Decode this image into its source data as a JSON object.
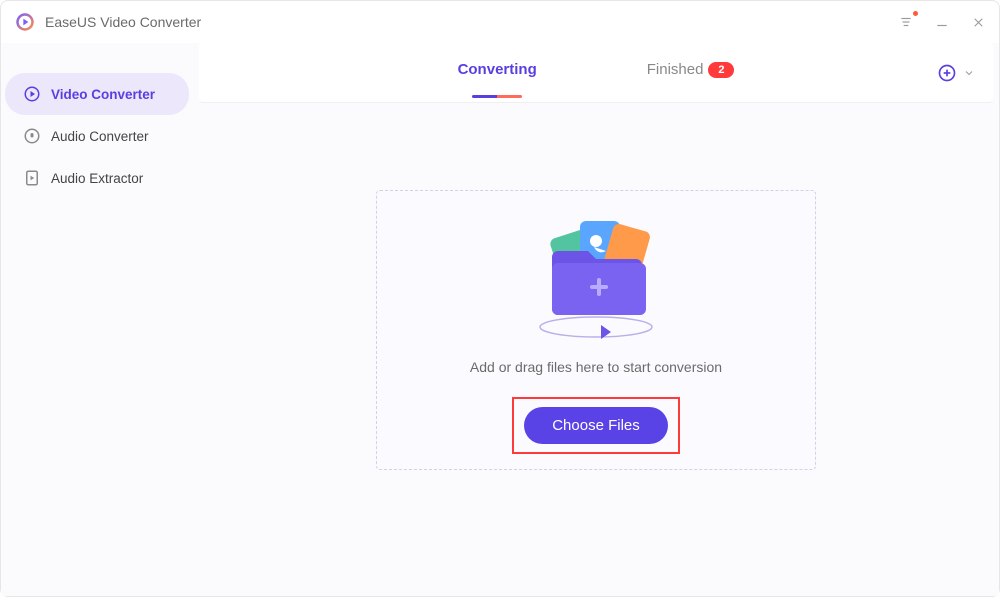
{
  "app": {
    "title": "EaseUS Video Converter"
  },
  "sidebar": {
    "items": [
      {
        "label": "Video Converter"
      },
      {
        "label": "Audio Converter"
      },
      {
        "label": "Audio Extractor"
      }
    ]
  },
  "tabs": {
    "converting": "Converting",
    "finished": "Finished",
    "finished_badge": "2"
  },
  "main": {
    "drop_text": "Add or drag files here to start conversion",
    "choose_label": "Choose Files"
  }
}
